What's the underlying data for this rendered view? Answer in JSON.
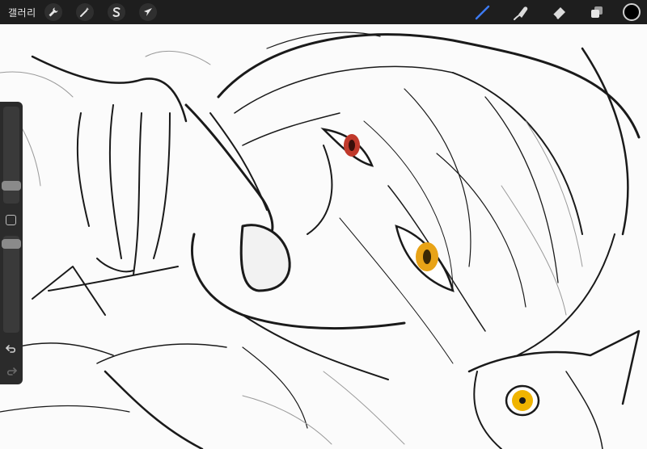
{
  "topbar": {
    "gallery_label": "갤러리",
    "left_tools": [
      {
        "name": "actions",
        "icon": "wrench-icon"
      },
      {
        "name": "adjustments",
        "icon": "magic-wand-icon"
      },
      {
        "name": "selection",
        "icon": "selection-s-icon"
      },
      {
        "name": "transform",
        "icon": "arrow-cursor-icon"
      }
    ],
    "right_tools": [
      {
        "name": "brush",
        "icon": "brush-icon",
        "active": true
      },
      {
        "name": "smudge",
        "icon": "smudge-icon",
        "active": false
      },
      {
        "name": "eraser",
        "icon": "eraser-icon",
        "active": false
      },
      {
        "name": "layers",
        "icon": "layers-icon",
        "active": false
      }
    ],
    "current_color": "#000000",
    "accent_color": "#3d7bf7"
  },
  "sidebar": {
    "brush_size_level": 0.25,
    "opacity_level": 0.95
  },
  "canvas": {
    "eye_color_left": "#e8a317",
    "eye_color_right": "#c0392b",
    "cat_eye_color": "#f0b400"
  }
}
